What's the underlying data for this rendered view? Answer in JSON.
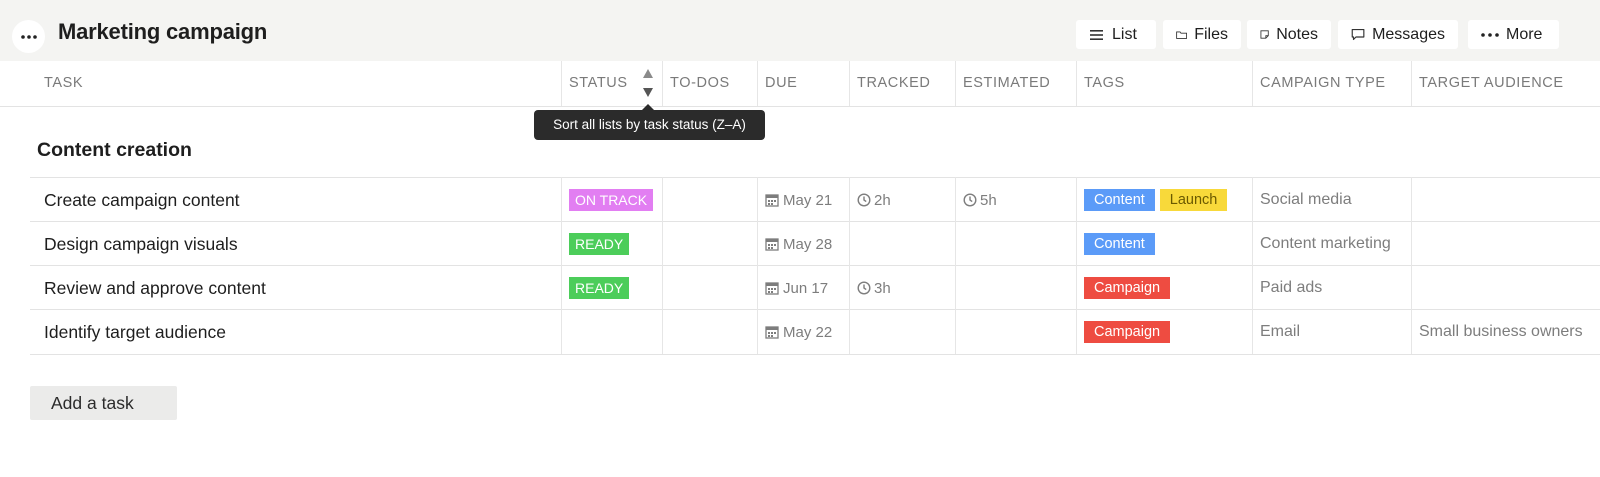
{
  "header": {
    "title": "Marketing campaign",
    "buttons": [
      {
        "label": "List",
        "icon": "list-icon"
      },
      {
        "label": "Files",
        "icon": "folder-icon"
      },
      {
        "label": "Notes",
        "icon": "note-icon"
      },
      {
        "label": "Messages",
        "icon": "message-icon"
      },
      {
        "label": "More",
        "icon": "more-dots-icon"
      }
    ]
  },
  "columns": [
    "TASK",
    "STATUS",
    "TO-DOS",
    "DUE",
    "TRACKED",
    "ESTIMATED",
    "TAGS",
    "CAMPAIGN TYPE",
    "TARGET AUDIENCE"
  ],
  "tooltip": "Sort all lists by task status (Z–A)",
  "section": {
    "title": "Content creation",
    "tasks": [
      {
        "name": "Create campaign content",
        "status": "ON TRACK",
        "due": "May 21",
        "tracked": "2h",
        "estimated": "5h",
        "tags": [
          "Content",
          "Launch"
        ],
        "campaign_type": "Social media",
        "target_audience": ""
      },
      {
        "name": "Design campaign visuals",
        "status": "READY",
        "due": "May 28",
        "tracked": "",
        "estimated": "",
        "tags": [
          "Content"
        ],
        "campaign_type": "Content marketing",
        "target_audience": ""
      },
      {
        "name": "Review and approve content",
        "status": "READY",
        "due": "Jun 17",
        "tracked": "3h",
        "estimated": "",
        "tags": [
          "Campaign"
        ],
        "campaign_type": "Paid ads",
        "target_audience": ""
      },
      {
        "name": "Identify target audience",
        "status": "",
        "due": "May 22",
        "tracked": "",
        "estimated": "",
        "tags": [
          "Campaign"
        ],
        "campaign_type": "Email",
        "target_audience": "Small business owners"
      }
    ]
  },
  "add_task_label": "Add a task",
  "colors": {
    "header_bg": "#f4f4f2",
    "status_on_track": "#e27ef2",
    "status_ready": "#4ccd5a",
    "tag_content": "#5b9bf8",
    "tag_launch": "#f8d93a",
    "tag_campaign": "#ee4c41",
    "tooltip_bg": "#2b2b2b"
  }
}
